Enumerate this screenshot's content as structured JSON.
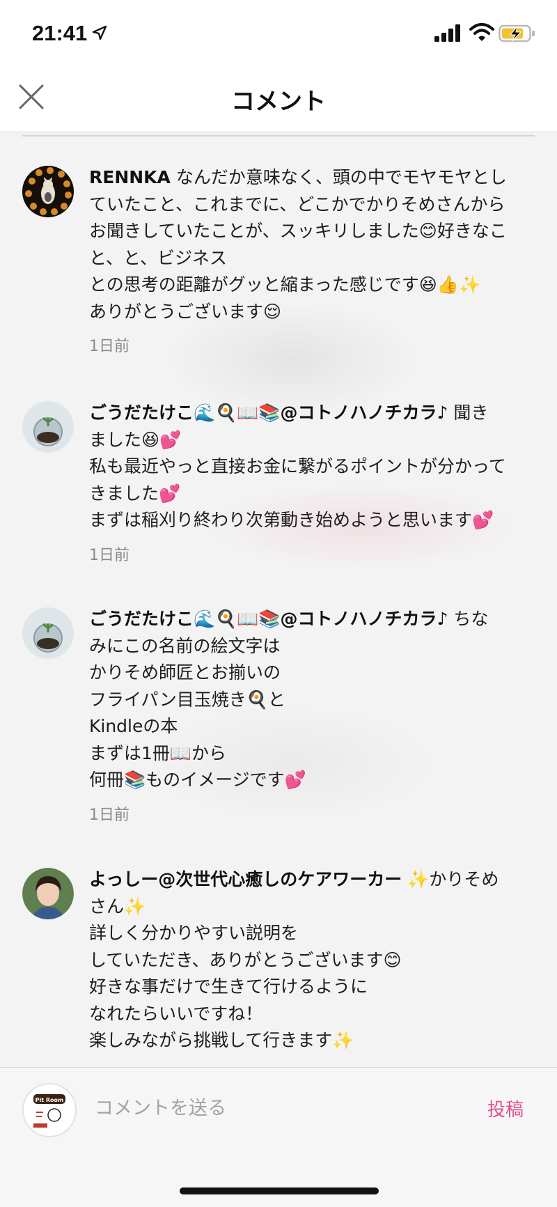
{
  "status_bar": {
    "time": "21:41"
  },
  "header": {
    "title": "コメント"
  },
  "comments": [
    {
      "author": "RENNKA",
      "lines": [
        " なんだか意味なく、頭の中でモヤモヤとし",
        "ていたこと、これまでに、どこかでかりそめさんから",
        "お聞きしていたことが、スッキリしました😊好きなこ",
        "と、と、ビジネス",
        "との思考の距離がグッと縮まった感じです😆👍✨",
        "ありがとうございます😌"
      ],
      "time_ago": "1日前"
    },
    {
      "author": "ごうだたけこ🌊🍳📖📚@コトノハノチカラ♪",
      "lines": [
        " 聞き",
        "ました😆💕",
        "私も最近やっと直接お金に繋がるポイントが分かって",
        "きました💕",
        "まずは稲刈り終わり次第動き始めようと思います💕"
      ],
      "time_ago": "1日前"
    },
    {
      "author": "ごうだたけこ🌊🍳📖📚@コトノハノチカラ♪",
      "lines": [
        " ちな",
        "みにこの名前の絵文字は",
        "かりそめ師匠とお揃いの",
        "フライパン目玉焼き🍳と",
        "Kindleの本",
        "まずは1冊📖から",
        "何冊📚ものイメージです💕"
      ],
      "time_ago": "1日前"
    },
    {
      "author": "よっしー@次世代心癒しのケアワーカー",
      "lines": [
        " ✨かりそめ",
        "さん✨",
        "詳しく分かりやすい説明を",
        "していただき、ありがとうございます😊",
        "好きな事だけで生きて行けるように",
        "なれたらいいですね！",
        "楽しみながら挑戦して行きます✨"
      ],
      "time_ago": ""
    }
  ],
  "composer": {
    "placeholder": "コメントを送る",
    "post_label": "投稿",
    "avatar_text": "Pit Room"
  },
  "colors": {
    "accent": "#e74d8e"
  }
}
